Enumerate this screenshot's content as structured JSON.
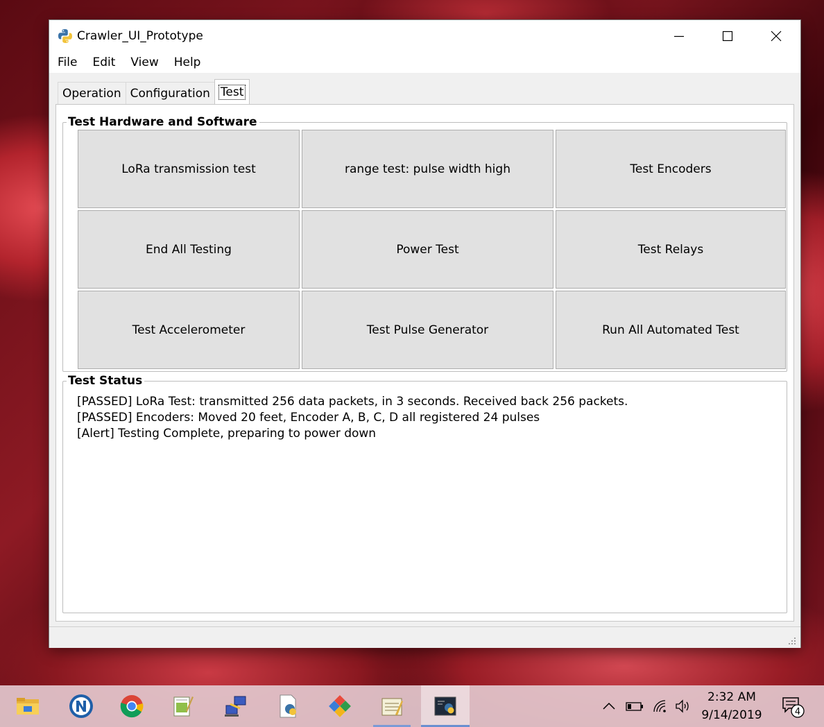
{
  "window": {
    "title": "Crawler_UI_Prototype"
  },
  "menu": [
    "File",
    "Edit",
    "View",
    "Help"
  ],
  "tabs": [
    {
      "label": "Operation",
      "active": false
    },
    {
      "label": "Configuration",
      "active": false
    },
    {
      "label": "Test",
      "active": true
    }
  ],
  "hardware_group": {
    "title": "Test Hardware and Software",
    "buttons": [
      "LoRa transmission test",
      "range test: pulse width high",
      "Test Encoders",
      "End All Testing",
      "Power Test",
      "Test Relays",
      "Test Accelerometer",
      "Test Pulse Generator",
      "Run All Automated Test"
    ]
  },
  "status_group": {
    "title": "Test Status",
    "lines": [
      "[PASSED] LoRa Test: transmitted 256 data packets, in 3 seconds. Received back 256 packets.",
      "[PASSED] Encoders: Moved 20 feet, Encoder A, B, C, D all registered 24 pulses",
      "[Alert] Testing Complete, preparing to power down"
    ]
  },
  "taskbar": {
    "apps": [
      "file-explorer-icon",
      "n-app-icon",
      "chrome-icon",
      "notepad-icon",
      "network-app-icon",
      "python-file-icon",
      "colorful-app-icon",
      "editor-app-icon",
      "python-app-icon"
    ],
    "clock": {
      "time": "2:32 AM",
      "date": "9/14/2019"
    },
    "notification_count": "4"
  },
  "colors": {
    "button_face": "#e1e1e1",
    "button_border": "#adadad",
    "window_bg": "#f0f0f0",
    "accent": "#6a8fd0"
  }
}
